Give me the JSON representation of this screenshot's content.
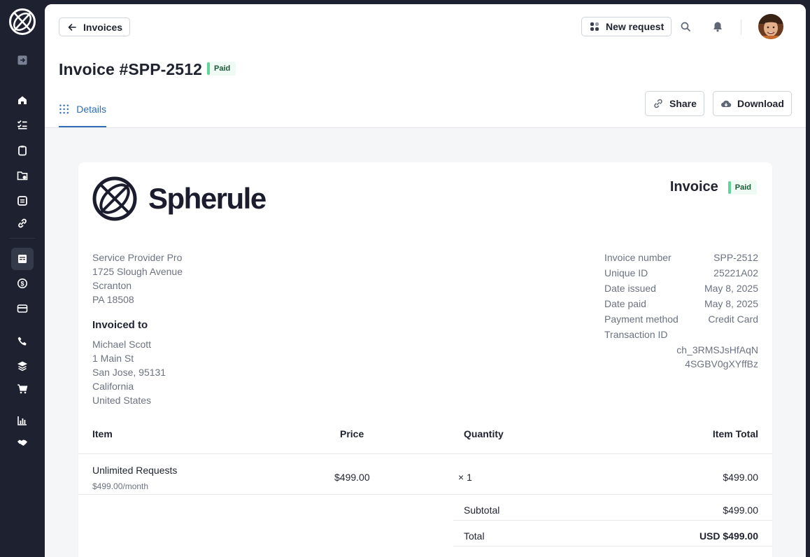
{
  "header": {
    "back_label": "Invoices",
    "new_request_label": "New request",
    "title": "Invoice #SPP-2512",
    "status": "Paid",
    "tab_details": "Details",
    "share_label": "Share",
    "download_label": "Download"
  },
  "sidebar": {
    "items": [
      "logout-icon",
      "home-icon",
      "tasks-icon",
      "clipboard-icon",
      "folder-icon",
      "forms-icon",
      "link-icon",
      "invoices-icon",
      "billing-icon",
      "card-icon",
      "phone-icon",
      "layers-icon",
      "cart-icon",
      "chart-icon",
      "handshake-icon"
    ],
    "active": "invoices-icon"
  },
  "invoice": {
    "brand": "Spherule",
    "heading": "Invoice",
    "status": "Paid",
    "provider": {
      "name": "Service Provider Pro",
      "street": "1725 Slough Avenue",
      "city": "Scranton",
      "state_zip": "PA 18508"
    },
    "invoiced_to_label": "Invoiced to",
    "customer": {
      "name": "Michael Scott",
      "street": "1 Main St",
      "city_zip": "San Jose, 95131",
      "state": "California",
      "country": "United States"
    },
    "meta": [
      {
        "label": "Invoice number",
        "value": "SPP-2512"
      },
      {
        "label": "Unique ID",
        "value": "25221A02"
      },
      {
        "label": "Date issued",
        "value": "May 8, 2025"
      },
      {
        "label": "Date paid",
        "value": "May 8, 2025"
      },
      {
        "label": "Payment method",
        "value": "Credit Card"
      }
    ],
    "transaction_label": "Transaction ID",
    "transaction_line1": "ch_3RMSJsHfAqN",
    "transaction_line2": "4SGBV0gXYffBz",
    "columns": {
      "item": "Item",
      "price": "Price",
      "quantity": "Quantity",
      "total": "Item Total"
    },
    "line_items": [
      {
        "name": "Unlimited Requests",
        "detail": "$499.00/month",
        "price": "$499.00",
        "quantity": "× 1",
        "total": "$499.00"
      }
    ],
    "subtotal_label": "Subtotal",
    "subtotal": "$499.00",
    "total_label": "Total",
    "total": "USD $499.00"
  },
  "colors": {
    "sidebar_bg": "#1e2230",
    "accent": "#2f6db5",
    "paid_bar": "#62d39a",
    "paid_bg": "#eefaf3"
  }
}
